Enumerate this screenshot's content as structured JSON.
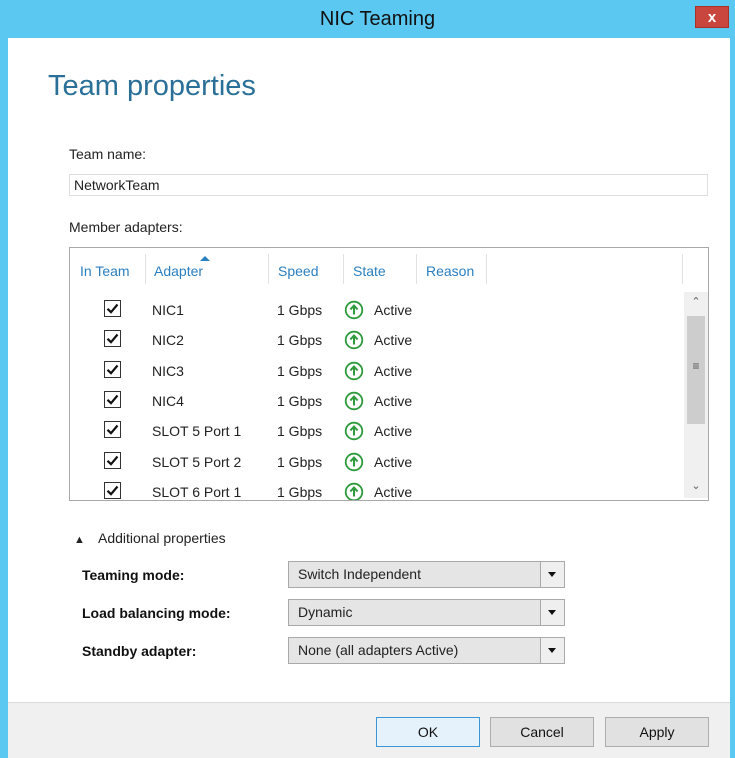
{
  "window": {
    "title": "NIC Teaming",
    "close_glyph": "x"
  },
  "page": {
    "heading": "Team properties"
  },
  "team_name": {
    "label": "Team name:",
    "value": "NetworkTeam"
  },
  "members": {
    "label": "Member adapters:",
    "columns": {
      "in_team": "In Team",
      "adapter": "Adapter",
      "speed": "Speed",
      "state": "State",
      "reason": "Reason"
    },
    "sorted_column": "Adapter",
    "rows": [
      {
        "checked": true,
        "adapter": "NIC1",
        "speed": "1 Gbps",
        "state": "Active"
      },
      {
        "checked": true,
        "adapter": "NIC2",
        "speed": "1 Gbps",
        "state": "Active"
      },
      {
        "checked": true,
        "adapter": "NIC3",
        "speed": "1 Gbps",
        "state": "Active"
      },
      {
        "checked": true,
        "adapter": "NIC4",
        "speed": "1 Gbps",
        "state": "Active"
      },
      {
        "checked": true,
        "adapter": "SLOT 5 Port 1",
        "speed": "1 Gbps",
        "state": "Active"
      },
      {
        "checked": true,
        "adapter": "SLOT 5 Port 2",
        "speed": "1 Gbps",
        "state": "Active"
      },
      {
        "checked": true,
        "adapter": "SLOT 6 Port 1",
        "speed": "1 Gbps",
        "state": "Active"
      }
    ],
    "state_icon": "green-up-arrow-circle-icon"
  },
  "additional": {
    "toggle_label": "Additional properties",
    "expanded": true,
    "teaming_mode": {
      "label": "Teaming mode:",
      "value": "Switch Independent"
    },
    "load_balancing": {
      "label": "Load balancing mode:",
      "value": "Dynamic"
    },
    "standby": {
      "label": "Standby adapter:",
      "value": "None (all adapters Active)"
    }
  },
  "buttons": {
    "ok": "OK",
    "cancel": "Cancel",
    "apply": "Apply"
  },
  "colors": {
    "titlebar": "#5bc8f2",
    "heading": "#2a6f97",
    "column_header": "#2a7fc0",
    "close": "#c8463d",
    "active_icon": "#2e9a3c"
  }
}
